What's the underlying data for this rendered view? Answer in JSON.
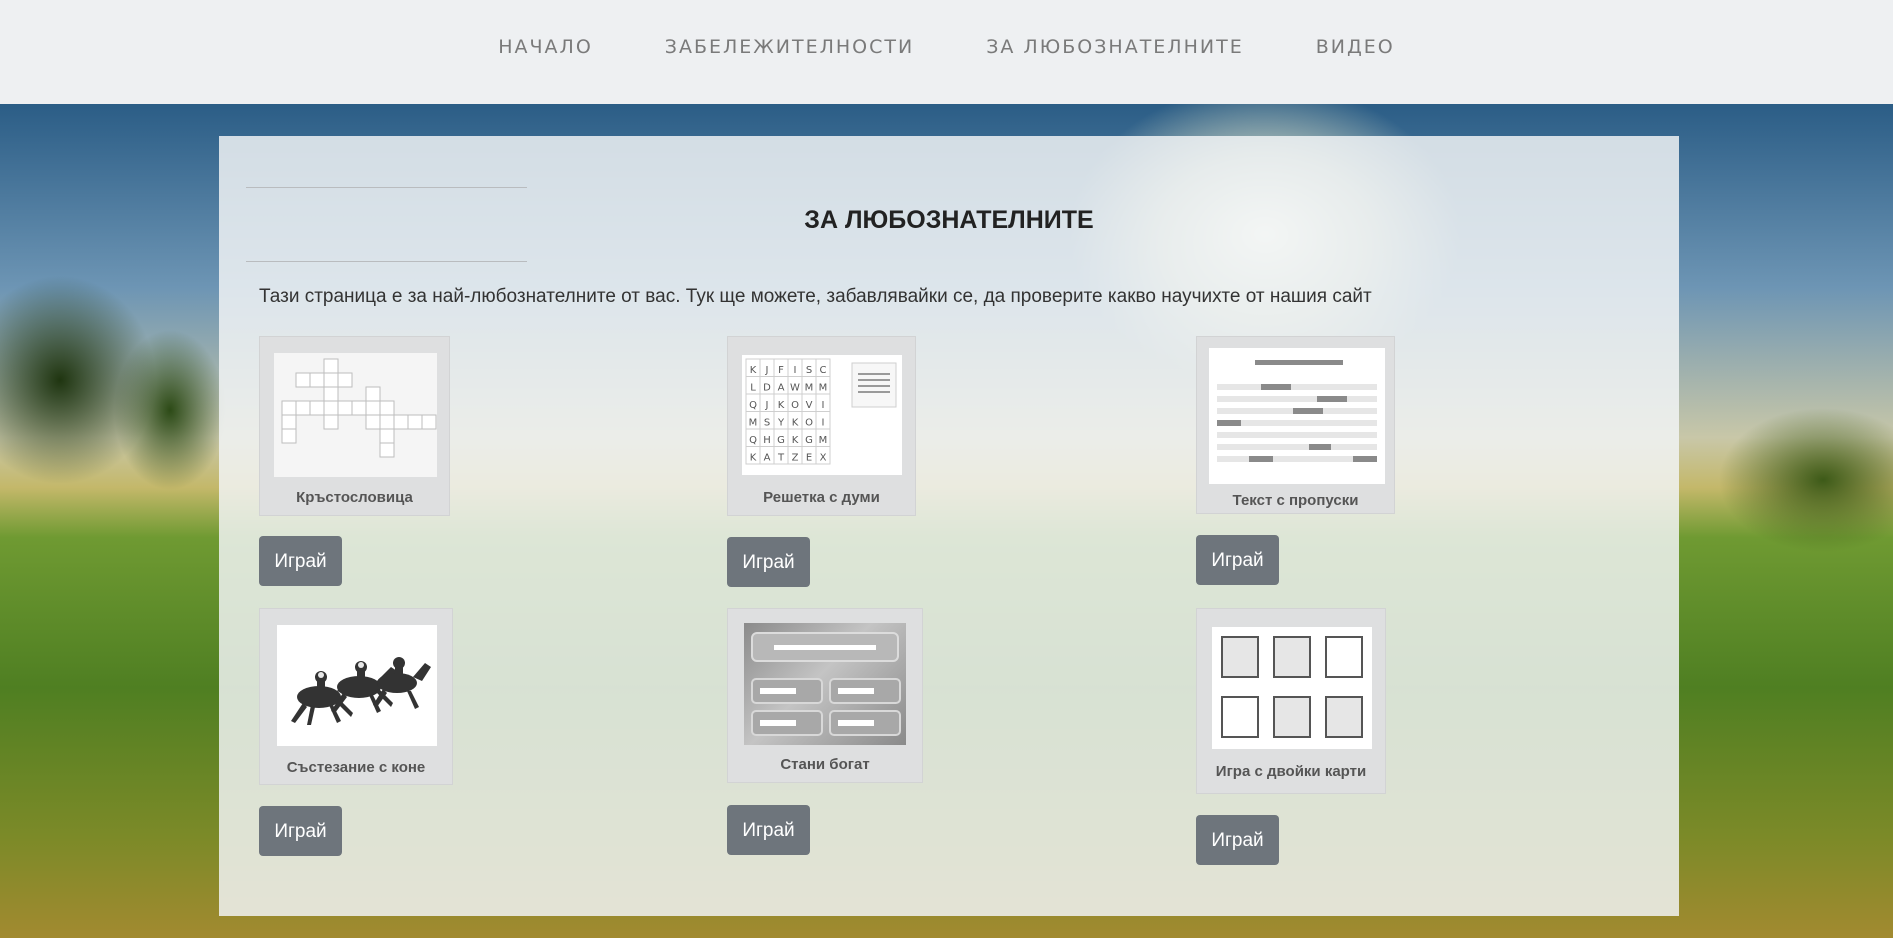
{
  "nav": {
    "items": [
      {
        "label": "НАЧАЛО"
      },
      {
        "label": "ЗАБЕЛЕЖИТЕЛНОСТИ"
      },
      {
        "label": "ЗА ЛЮБОЗНАТЕЛНИТЕ"
      },
      {
        "label": "ВИДЕО"
      }
    ]
  },
  "page": {
    "title": "ЗА ЛЮБОЗНАТЕЛНИТЕ",
    "intro": "Тази страница е за най-любознателните от вас. Тук ще можете, забавлявайки се, да проверите какво научихте от нашия сайт"
  },
  "games": [
    {
      "label": "Кръстословица",
      "button": "Играй",
      "icon": "crossword-icon"
    },
    {
      "label": "Решетка с думи",
      "button": "Играй",
      "icon": "word-grid-icon",
      "grid": [
        "KJFISC",
        "LDAWMM",
        "QJKOVI",
        "MSYKOI",
        "QHGKGM",
        "KATZEX"
      ]
    },
    {
      "label": "Текст с пропуски",
      "button": "Играй",
      "icon": "fill-blanks-icon"
    },
    {
      "label": "Състезание с коне",
      "button": "Играй",
      "icon": "horse-race-icon"
    },
    {
      "label": "Стани богат",
      "button": "Играй",
      "icon": "quiz-icon"
    },
    {
      "label": "Игра с двойки карти",
      "button": "Играй",
      "icon": "matching-cards-icon"
    }
  ]
}
